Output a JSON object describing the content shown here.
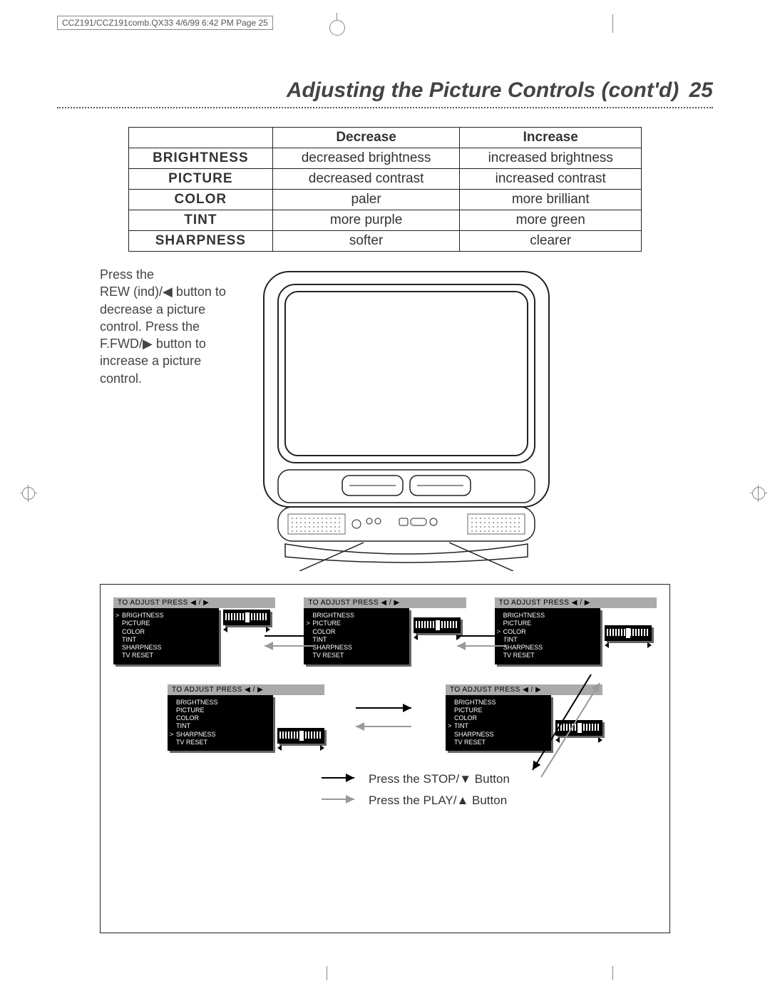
{
  "print": {
    "slug": "CCZ191/CCZ191comb.QX33  4/6/99 6:42 PM  Page 25"
  },
  "title": "Adjusting the Picture Controls (cont'd)",
  "page_number": "25",
  "controls_table": {
    "headers": [
      "",
      "Decrease",
      "Increase"
    ],
    "rows": [
      {
        "label": "BRIGHTNESS",
        "decrease": "decreased brightness",
        "increase": "increased brightness"
      },
      {
        "label": "PICTURE",
        "decrease": "decreased contrast",
        "increase": "increased contrast"
      },
      {
        "label": "COLOR",
        "decrease": "paler",
        "increase": "more brilliant"
      },
      {
        "label": "TINT",
        "decrease": "more purple",
        "increase": "more green"
      },
      {
        "label": "SHARPNESS",
        "decrease": "softer",
        "increase": "clearer"
      }
    ]
  },
  "instructions": {
    "line1": "Press the",
    "line2": "REW (ind)/◀ button to decrease a picture control. Press the",
    "line3": "F.FWD/▶ button to increase a picture control."
  },
  "osd": {
    "header": "TO ADJUST PRESS ◀ / ▶",
    "items": [
      "BRIGHTNESS",
      "PICTURE",
      "COLOR",
      "TINT",
      "SHARPNESS",
      "TV RESET"
    ],
    "selected_top": [
      "BRIGHTNESS",
      "PICTURE",
      "COLOR"
    ],
    "selected_bottom": [
      "SHARPNESS",
      "TINT"
    ]
  },
  "legend": {
    "stop": "Press the STOP/▼ Button",
    "play": "Press the PLAY/▲ Button"
  }
}
